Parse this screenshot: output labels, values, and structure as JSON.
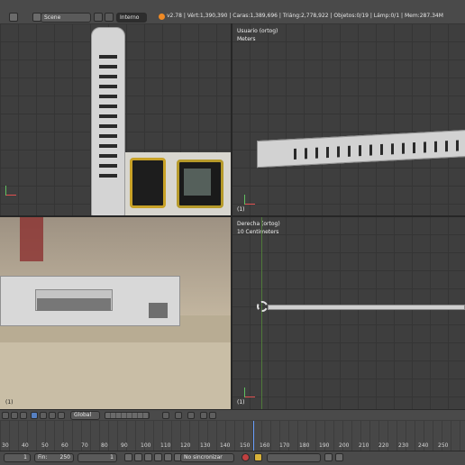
{
  "header": {
    "scene_name": "Scene",
    "engine": "Interno",
    "stats": "v2.78 | Vért:1,390,390 | Caras:1,389,696 | Triáng:2,778,922 | Objetos:0/19 | Lámp:0/1 | Mem:287.34M"
  },
  "viewports": {
    "top_right": {
      "view": "Usuario (ortog)",
      "units": "Meters",
      "count": "(1)"
    },
    "bottom_right": {
      "view": "Derecha (ortog)",
      "units": "10 Centimeters",
      "count": "(1)"
    },
    "bottom_left": {
      "count": "(1)"
    }
  },
  "toolbar": {
    "orientation": "Global"
  },
  "timeline": {
    "ticks": [
      "30",
      "40",
      "50",
      "60",
      "70",
      "80",
      "90",
      "100",
      "110",
      "120",
      "130",
      "140",
      "150",
      "160",
      "170",
      "180",
      "190",
      "200",
      "210",
      "220",
      "230",
      "240",
      "250"
    ]
  },
  "playback": {
    "start_value": "1",
    "end_label": "Fin:",
    "end_value": "250",
    "current_frame": "1",
    "sync": "No sincronizar"
  }
}
